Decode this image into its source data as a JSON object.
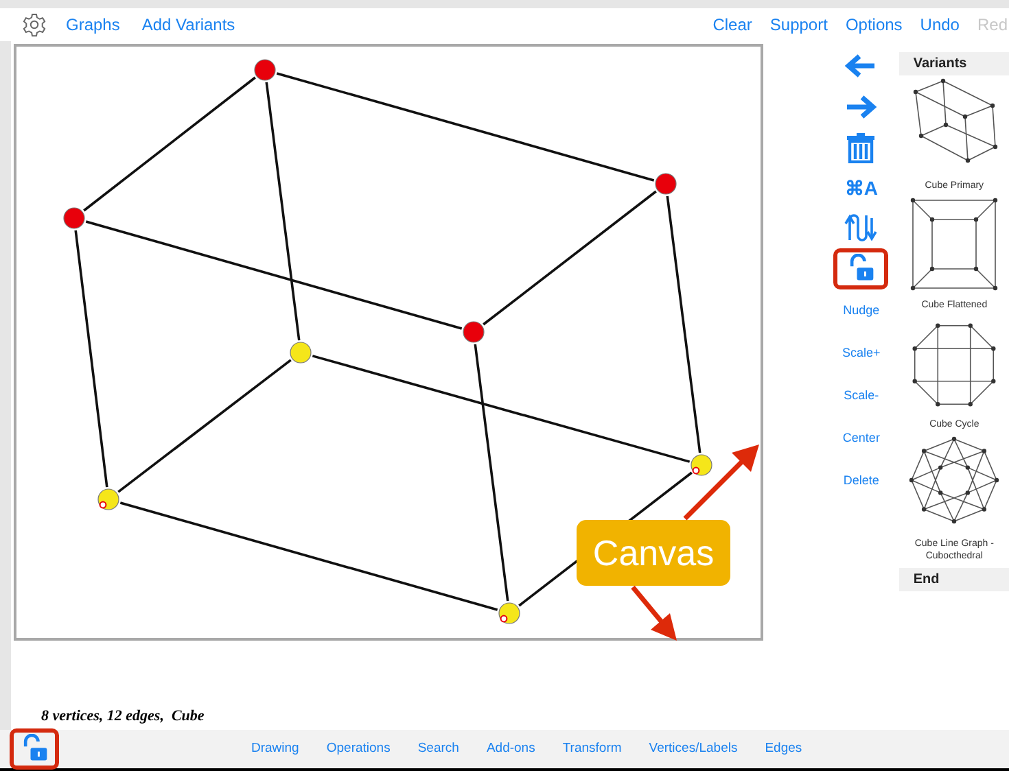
{
  "top_bar": {
    "left": [
      {
        "label": "Graphs",
        "disabled": false
      },
      {
        "label": "Add Variants",
        "disabled": false
      }
    ],
    "right": [
      {
        "label": "Clear",
        "disabled": false
      },
      {
        "label": "Support",
        "disabled": false
      },
      {
        "label": "Options",
        "disabled": false
      },
      {
        "label": "Undo",
        "disabled": false
      },
      {
        "label": "Red",
        "disabled": true
      }
    ]
  },
  "canvas": {
    "vertices": [
      {
        "color": "#e8000b",
        "marked": false
      },
      {
        "color": "#e8000b",
        "marked": false
      },
      {
        "color": "#e8000b",
        "marked": false
      },
      {
        "color": "#e8000b",
        "marked": false
      },
      {
        "color": "#f5e61a",
        "marked": false
      },
      {
        "color": "#f5e61a",
        "marked": true
      },
      {
        "color": "#f5e61a",
        "marked": true
      },
      {
        "color": "#f5e61a",
        "marked": true
      }
    ],
    "callout": {
      "label": "Canvas"
    }
  },
  "toolbar": [
    {
      "kind": "back",
      "highlighted": false
    },
    {
      "kind": "forward",
      "highlighted": false
    },
    {
      "kind": "trash",
      "highlighted": false
    },
    {
      "kind": "text",
      "label": "⌘A",
      "highlighted": false
    },
    {
      "kind": "swap",
      "highlighted": false
    },
    {
      "kind": "lock",
      "highlighted": true
    },
    {
      "kind": "link",
      "label": "Nudge",
      "highlighted": false
    },
    {
      "kind": "link",
      "label": "Scale+",
      "highlighted": false
    },
    {
      "kind": "link",
      "label": "Scale-",
      "highlighted": false
    },
    {
      "kind": "link",
      "label": "Center",
      "highlighted": false
    },
    {
      "kind": "link",
      "label": "Delete",
      "highlighted": false
    }
  ],
  "variants": {
    "header": "Variants",
    "items": [
      {
        "kind": "prism",
        "label": "Cube Primary"
      },
      {
        "kind": "square",
        "label": "Cube Flattened"
      },
      {
        "kind": "cycle",
        "label": "Cube Cycle"
      },
      {
        "kind": "cuboctahedral",
        "label": "Cube Line Graph - Cubocthedral"
      }
    ],
    "footer": "End"
  },
  "status": "8 vertices, 12 edges,  Cube",
  "bottom_bar": {
    "lock": {
      "highlighted": true
    },
    "tabs": [
      {
        "label": "Drawing"
      },
      {
        "label": "Operations"
      },
      {
        "label": "Search"
      },
      {
        "label": "Add-ons"
      },
      {
        "label": "Transform"
      },
      {
        "label": "Vertices/Labels"
      },
      {
        "label": "Edges"
      }
    ]
  }
}
